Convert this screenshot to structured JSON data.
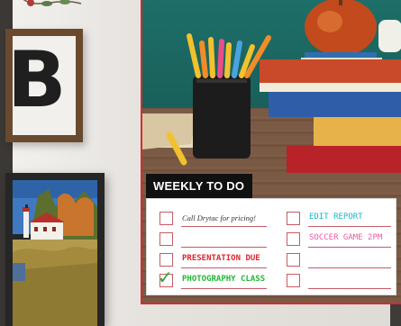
{
  "todo": {
    "heading": "WEEKLY TO DO LIST",
    "left_items": [
      {
        "text": "Call Drytac for pricing!",
        "checked": false
      },
      {
        "text": "",
        "checked": false
      },
      {
        "text": "PRESENTATION DUE",
        "checked": false
      },
      {
        "text": "PHOTOGRAPHY CLASS",
        "checked": true
      }
    ],
    "right_items": [
      {
        "text": "EDIT REPORT",
        "checked": false
      },
      {
        "text": "SOCCER GAME 2PM",
        "checked": false
      },
      {
        "text": "",
        "checked": false
      },
      {
        "text": "",
        "checked": false
      }
    ]
  },
  "wall_letter": "B",
  "colors": {
    "border_red": "#d52a2e",
    "task_red": "#e0262d",
    "task_green": "#21b733",
    "task_teal": "#15b7c4",
    "task_pink": "#ef5ba1"
  }
}
